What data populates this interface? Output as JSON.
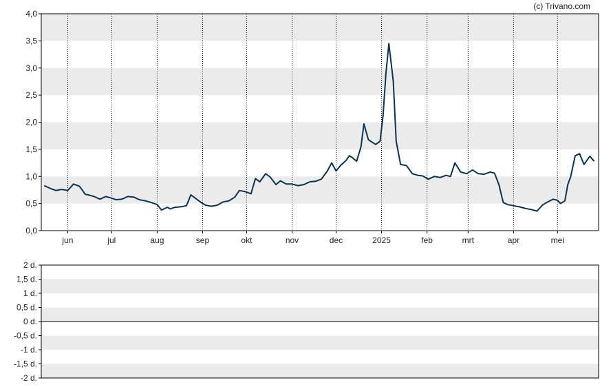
{
  "credit": "(c) Trivano.com",
  "colors": {
    "line": "#0b3350",
    "band": "#ebebeb",
    "axis": "#000000",
    "grid": "#000000"
  },
  "chart_data": [
    {
      "type": "line",
      "title": "",
      "xlabel": "",
      "ylabel": "",
      "ylim": [
        0,
        4
      ],
      "y_ticks": [
        "0,0",
        "0,5",
        "1,0",
        "1,5",
        "2,0",
        "2,5",
        "3,0",
        "3,5",
        "4,0"
      ],
      "x_ticks": [
        "jun",
        "jul",
        "aug",
        "sep",
        "okt",
        "nov",
        "dec",
        "2025",
        "feb",
        "mrt",
        "apr",
        "mei"
      ],
      "grid": "vertical dotted lines at month starts, alternating horizontal bands",
      "legend": "none",
      "series": [
        {
          "x": [
            "2024-05-16",
            "2024-05-20",
            "2024-05-24",
            "2024-05-28",
            "2024-06-01",
            "2024-06-05",
            "2024-06-09",
            "2024-06-13",
            "2024-06-15",
            "2024-06-19",
            "2024-06-23",
            "2024-06-27",
            "2024-07-01",
            "2024-07-04",
            "2024-07-08",
            "2024-07-12",
            "2024-07-16",
            "2024-07-20",
            "2024-07-24",
            "2024-07-28",
            "2024-08-01",
            "2024-08-04",
            "2024-08-08",
            "2024-08-10",
            "2024-08-13",
            "2024-08-17",
            "2024-08-21",
            "2024-08-24",
            "2024-08-27",
            "2024-08-31",
            "2024-09-03",
            "2024-09-07",
            "2024-09-11",
            "2024-09-15",
            "2024-09-19",
            "2024-09-23",
            "2024-09-26",
            "2024-09-30",
            "2024-10-04",
            "2024-10-07",
            "2024-10-10",
            "2024-10-14",
            "2024-10-17",
            "2024-10-21",
            "2024-10-24",
            "2024-10-28",
            "2024-11-01",
            "2024-11-05",
            "2024-11-09",
            "2024-11-13",
            "2024-11-17",
            "2024-11-21",
            "2024-11-25",
            "2024-11-28",
            "2024-12-01",
            "2024-12-04",
            "2024-12-08",
            "2024-12-10",
            "2024-12-12",
            "2024-12-15",
            "2024-12-18",
            "2024-12-20",
            "2024-12-23",
            "2024-12-25",
            "2024-12-28",
            "2024-12-31",
            "2025-01-02",
            "2025-01-04",
            "2025-01-06",
            "2025-01-09",
            "2025-01-11",
            "2025-01-14",
            "2025-01-18",
            "2025-01-22",
            "2025-01-26",
            "2025-01-29",
            "2025-02-02",
            "2025-02-06",
            "2025-02-10",
            "2025-02-14",
            "2025-02-17",
            "2025-02-20",
            "2025-02-24",
            "2025-02-28",
            "2025-03-04",
            "2025-03-08",
            "2025-03-12",
            "2025-03-16",
            "2025-03-19",
            "2025-03-22",
            "2025-03-25",
            "2025-03-28",
            "2025-04-01",
            "2025-04-05",
            "2025-04-09",
            "2025-04-13",
            "2025-04-17",
            "2025-04-21",
            "2025-04-25",
            "2025-04-28",
            "2025-05-01",
            "2025-05-03",
            "2025-05-06",
            "2025-05-08",
            "2025-05-10",
            "2025-05-13",
            "2025-05-16",
            "2025-05-19",
            "2025-05-23",
            "2025-05-26"
          ],
          "y": [
            0.83,
            0.78,
            0.74,
            0.76,
            0.74,
            0.86,
            0.82,
            0.67,
            0.66,
            0.63,
            0.58,
            0.63,
            0.6,
            0.57,
            0.58,
            0.63,
            0.62,
            0.57,
            0.55,
            0.52,
            0.48,
            0.38,
            0.43,
            0.4,
            0.43,
            0.44,
            0.46,
            0.66,
            0.6,
            0.52,
            0.47,
            0.45,
            0.47,
            0.53,
            0.55,
            0.62,
            0.74,
            0.72,
            0.68,
            0.96,
            0.9,
            1.05,
            0.99,
            0.85,
            0.92,
            0.86,
            0.86,
            0.83,
            0.85,
            0.9,
            0.91,
            0.95,
            1.1,
            1.25,
            1.1,
            1.2,
            1.3,
            1.38,
            1.35,
            1.28,
            1.55,
            1.97,
            1.68,
            1.64,
            1.59,
            1.65,
            2.12,
            2.9,
            3.45,
            2.75,
            1.65,
            1.22,
            1.2,
            1.05,
            1.02,
            1.01,
            0.95,
            1.0,
            0.98,
            1.02,
            1.0,
            1.25,
            1.08,
            1.05,
            1.12,
            1.05,
            1.04,
            1.08,
            1.06,
            0.85,
            0.52,
            0.48,
            0.46,
            0.44,
            0.41,
            0.39,
            0.36,
            0.48,
            0.54,
            0.58,
            0.56,
            0.5,
            0.55,
            0.85,
            1.0,
            1.38,
            1.42,
            1.22,
            1.37,
            1.28
          ]
        }
      ]
    },
    {
      "type": "line",
      "title": "",
      "ylim": [
        -2,
        2
      ],
      "y_ticks": [
        "2 d.",
        "1,5 d.",
        "1 d.",
        "0,5 d.",
        "0 d.",
        "-0,5 d.",
        "-1 d.",
        "-1,5 d.",
        "-2 d."
      ],
      "grid": "alternating horizontal bands, zero line",
      "series": []
    }
  ]
}
